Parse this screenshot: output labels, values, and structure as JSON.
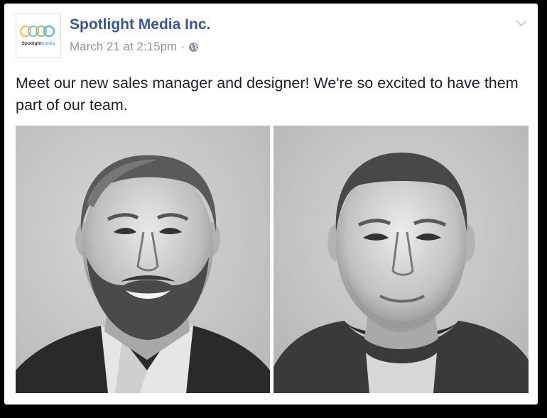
{
  "post": {
    "page_name": "Spotlight Media Inc.",
    "timestamp": "March 21 at 2:15pm",
    "separator": "·",
    "privacy_icon": "globe-icon",
    "text": "Meet our new sales manager and designer! We're so excited to have them part of our team."
  },
  "logo": {
    "wordmark": "Spotlightmedia",
    "colors": [
      "#f4c242",
      "#7cc6e0",
      "#a3c95a",
      "#5bb1e6"
    ]
  },
  "photos": [
    {
      "subject": "sales manager portrait",
      "style": "black and white"
    },
    {
      "subject": "designer portrait",
      "style": "black and white"
    }
  ],
  "colors": {
    "link": "#365899",
    "meta": "#90949c",
    "text": "#1d2129"
  },
  "icons": {
    "options": "chevron-down-icon"
  }
}
